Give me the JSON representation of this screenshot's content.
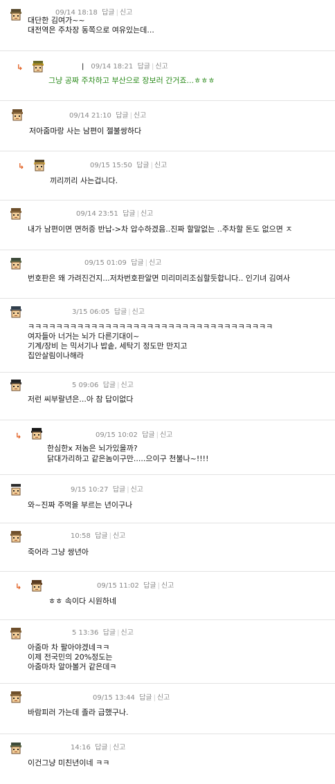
{
  "actions": {
    "reply": "답글",
    "report": "신고",
    "sep": "|"
  },
  "comments": [
    {
      "time": "09/14 18:18",
      "lines": [
        "대단한 김여가~~",
        "대전역은 주차장 동쪽으로 여유있는데..."
      ]
    },
    {
      "time": "09/14 18:21",
      "lines": [
        "그냥 공짜 주차하고 부산으로 장보러 간거죠...ㅎㅎㅎ"
      ]
    },
    {
      "time": "09/14 21:10",
      "lines": [
        "저아줌마랑 사는 남편이 젤불쌍하다"
      ]
    },
    {
      "time": "09/15 15:50",
      "lines": [
        "끼리끼리 사는겁니다."
      ]
    },
    {
      "time": "09/14 23:51",
      "lines": [
        "내가 남편이면 면허증 반납->차 압수하겠음..진짜 할말없는 ..주차할 돈도 없으면 ㅈ"
      ]
    },
    {
      "time": "09/15 01:09",
      "lines": [
        "번호판은 왜 가려진건지...저차번호판알면 미리미리조심할듯합니다.. 인기녀 김여사"
      ]
    },
    {
      "time": "3/15 06:05",
      "lines": [
        "ㅋㅋㅋㅋㅋㅋㅋㅋㅋㅋㅋㅋㅋㅋㅋㅋㅋㅋㅋㅋㅋㅋㅋㅋㅋㅋㅋㅋㅋㅋㅋㅋㅋㅋㅋ",
        "여자들아 너거는 뇌가 다른기대이~",
        "기계/장비 는 믹서기나 밥솥, 세탁기 정도만 만지고",
        "집안살림이나해라"
      ]
    },
    {
      "time": "5 09:06",
      "lines": [
        "저런 씨부랄년은...아 참 답이없다"
      ]
    },
    {
      "time": "09/15 10:02",
      "lines": [
        "한심한x 저놈은 뇌가있을까?",
        "닭대가리하고 같은놈이구만.....으이구 천불나~!!!!"
      ]
    },
    {
      "time": "9/15 10:27",
      "lines": [
        "와~진짜 주먹을 부르는 년이구나"
      ]
    },
    {
      "time": "10:58",
      "lines": [
        "죽어라 그냥 쌍년아"
      ]
    },
    {
      "time": "09/15 11:02",
      "lines": [
        "ㅎㅎ 속이다 시원하네"
      ]
    },
    {
      "time": "5 13:36",
      "lines": [
        "아줌마 차 팔아야겠네ㅋㅋ",
        "이제 전국민의 20%정도는",
        "아줌마차 알아볼거 같은데ㅋ"
      ]
    },
    {
      "time": "09/15 13:44",
      "lines": [
        "바람피러 가는데 졸라 급했구나."
      ]
    },
    {
      "time": "14:16",
      "lines": [
        "이건그냥 미친년이네 ㅋㅋ"
      ]
    }
  ]
}
